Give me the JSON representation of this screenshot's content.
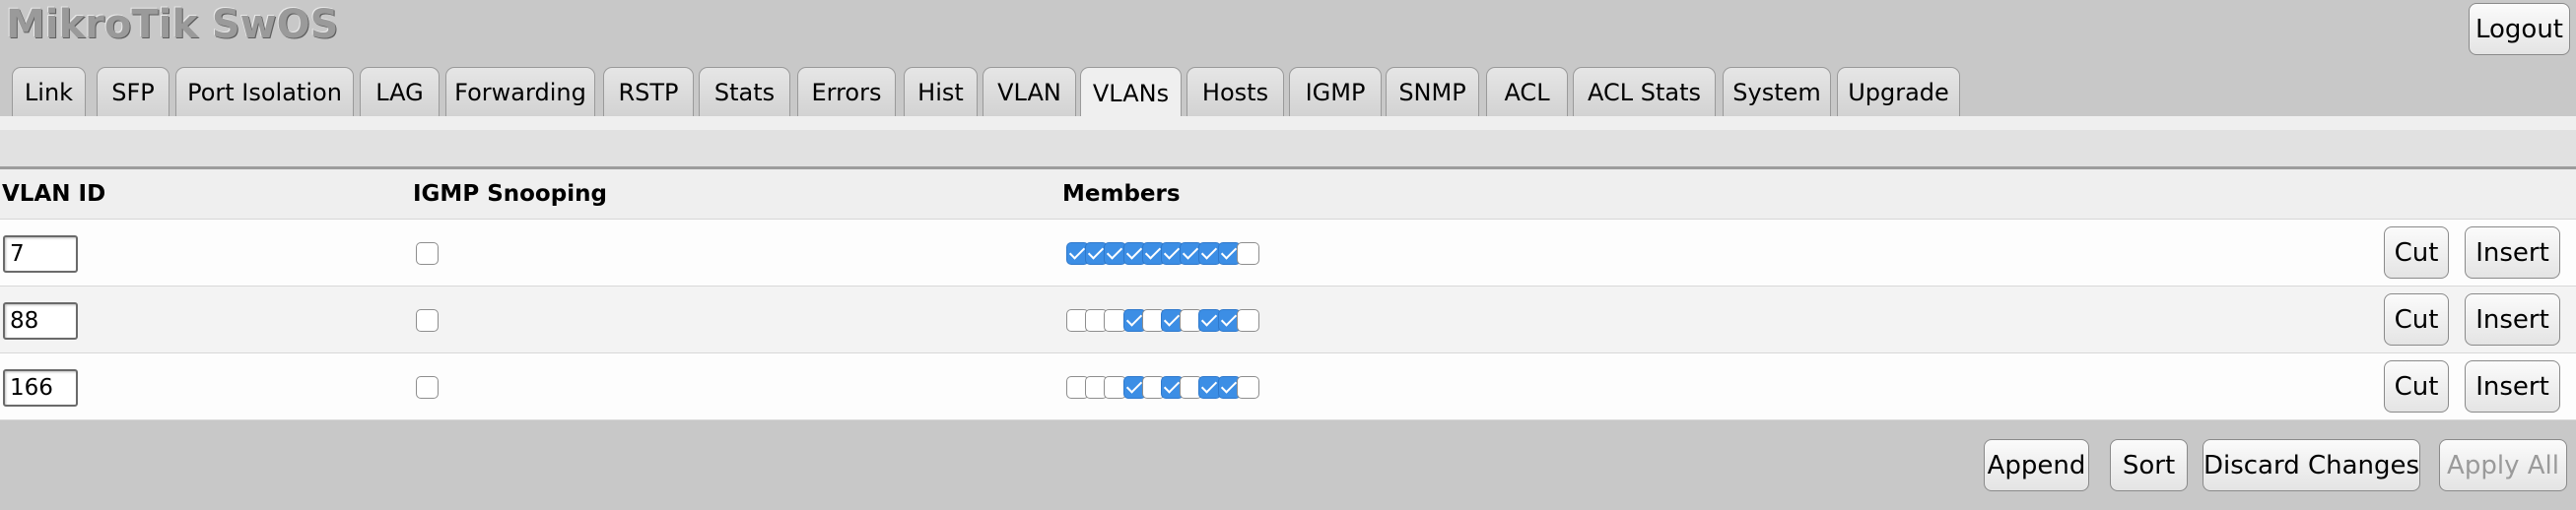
{
  "app": {
    "title": "MikroTik SwOS"
  },
  "header": {
    "logout_label": "Logout"
  },
  "tabs": [
    {
      "label": "Link",
      "active": false
    },
    {
      "label": "SFP",
      "active": false
    },
    {
      "label": "Port Isolation",
      "active": false
    },
    {
      "label": "LAG",
      "active": false
    },
    {
      "label": "Forwarding",
      "active": false
    },
    {
      "label": "RSTP",
      "active": false
    },
    {
      "label": "Stats",
      "active": false
    },
    {
      "label": "Errors",
      "active": false
    },
    {
      "label": "Hist",
      "active": false
    },
    {
      "label": "VLAN",
      "active": false
    },
    {
      "label": "VLANs",
      "active": true
    },
    {
      "label": "Hosts",
      "active": false
    },
    {
      "label": "IGMP",
      "active": false
    },
    {
      "label": "SNMP",
      "active": false
    },
    {
      "label": "ACL",
      "active": false
    },
    {
      "label": "ACL Stats",
      "active": false
    },
    {
      "label": "System",
      "active": false
    },
    {
      "label": "Upgrade",
      "active": false
    }
  ],
  "table": {
    "columns": {
      "vlan_id": "VLAN ID",
      "igmp": "IGMP Snooping",
      "members": "Members"
    },
    "rows": [
      {
        "vlan_id": "7",
        "igmp_snooping": false,
        "members": [
          true,
          true,
          true,
          true,
          true,
          true,
          true,
          true,
          true,
          false
        ]
      },
      {
        "vlan_id": "88",
        "igmp_snooping": false,
        "members": [
          false,
          false,
          false,
          true,
          false,
          true,
          false,
          true,
          true,
          false
        ]
      },
      {
        "vlan_id": "166",
        "igmp_snooping": false,
        "members": [
          false,
          false,
          false,
          true,
          false,
          true,
          false,
          true,
          true,
          false
        ]
      }
    ],
    "row_actions": {
      "cut_label": "Cut",
      "insert_label": "Insert"
    }
  },
  "actions": {
    "append_label": "Append",
    "sort_label": "Sort",
    "discard_label": "Discard Changes",
    "apply_label": "Apply All",
    "apply_enabled": false
  },
  "colors": {
    "background": "#c8c8c8",
    "checkbox_checked": "#3c8ee5",
    "title_gray": "#9a9a9a"
  }
}
